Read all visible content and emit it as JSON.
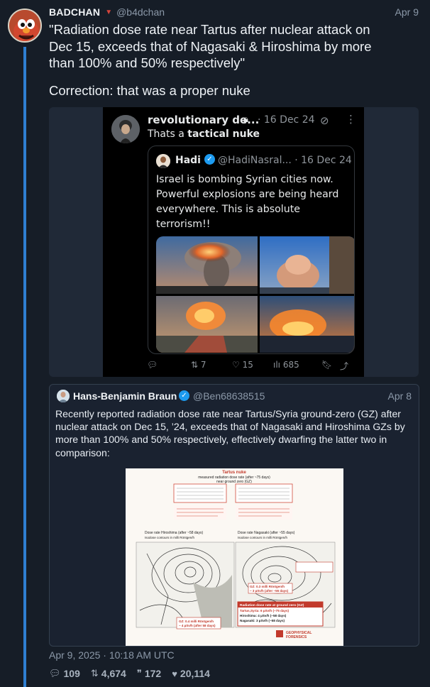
{
  "post": {
    "author": "BADCHAN",
    "handle": "@b4dchan",
    "date": "Apr 9",
    "text_lines": [
      "\"Radiation dose rate near Tartus after nuclear attack on",
      "Dec 15, exceeds that of Nagasaki & Hiroshima by more",
      "than 100% and 50% respectively\"",
      "Correction: that was a proper nuke"
    ],
    "timestamp": "Apr 9, 2025 · 10:18 AM UTC",
    "stats": {
      "replies": "109",
      "reposts": "4,674",
      "quotes": "172",
      "likes": "20,114"
    },
    "colors": {
      "background": "#161d27",
      "thread_line": "#2f7fd2",
      "accent_red": "#d6453c"
    }
  },
  "screenshot": {
    "author": "revolutionary de...",
    "lock_icon": "lock-icon",
    "date": "· 16 Dec 24",
    "text_prefix": "Thats a ",
    "text_bold": "tactical nuke",
    "quoted": {
      "name": "Hadi",
      "handle": "@HadiNasral... · 16 Dec 24",
      "text": "Israel is bombing Syrian cities now. Powerful explosions are being heard everywhere. This is absolute terrorism!!"
    },
    "actions": {
      "reposts": "7",
      "likes": "15",
      "views": "685"
    }
  },
  "quote_tweet": {
    "author": "Hans-Benjamin Braun",
    "handle": "@Ben68638515",
    "date": "Apr 8",
    "text": "Recently reported radiation dose rate near Tartus/Syria ground-zero (GZ) after nuclear attack on Dec 15, ’24, exceeds that of Nagasaki and Hiroshima GZs by more than 100% and 50% respectively, effectively dwarfing the latter two in comparison:",
    "figure": {
      "title": "Tartus nuke",
      "subtitle": "measured radiation dose rate (after ~75 days)",
      "subtitle2": "near ground zero (GZ)",
      "hiroshima_label": "Dose rate Hiroshima (after ~58 days)",
      "nagasaki_label": "Dose rate Nagasaki (after ~55 days)",
      "isodose": "Isodose contours in milli Röntgen/h",
      "summary_title": "Radiation dose rate at ground zero (GZ)",
      "summary_lines": [
        "Tartus,Syria: 6 µSv/h (~75 days)",
        "Hiroshima: 4 µSv/h (~58 days)",
        "Nagasaki: 3 µSv/h (~58 days)"
      ],
      "gz_h": "GZ: 0.4 milli Röntgen/h",
      "gz_h2": "~ 4 µSv/h (after 58 days)",
      "gz_n": "GZ: 0.3 milli Röntgen/h",
      "gz_n2": "~ 3 µSv/h (after ~55 days)",
      "logo_line1": "GEOPHYSICAL",
      "logo_line2": "FORENSICS"
    }
  }
}
